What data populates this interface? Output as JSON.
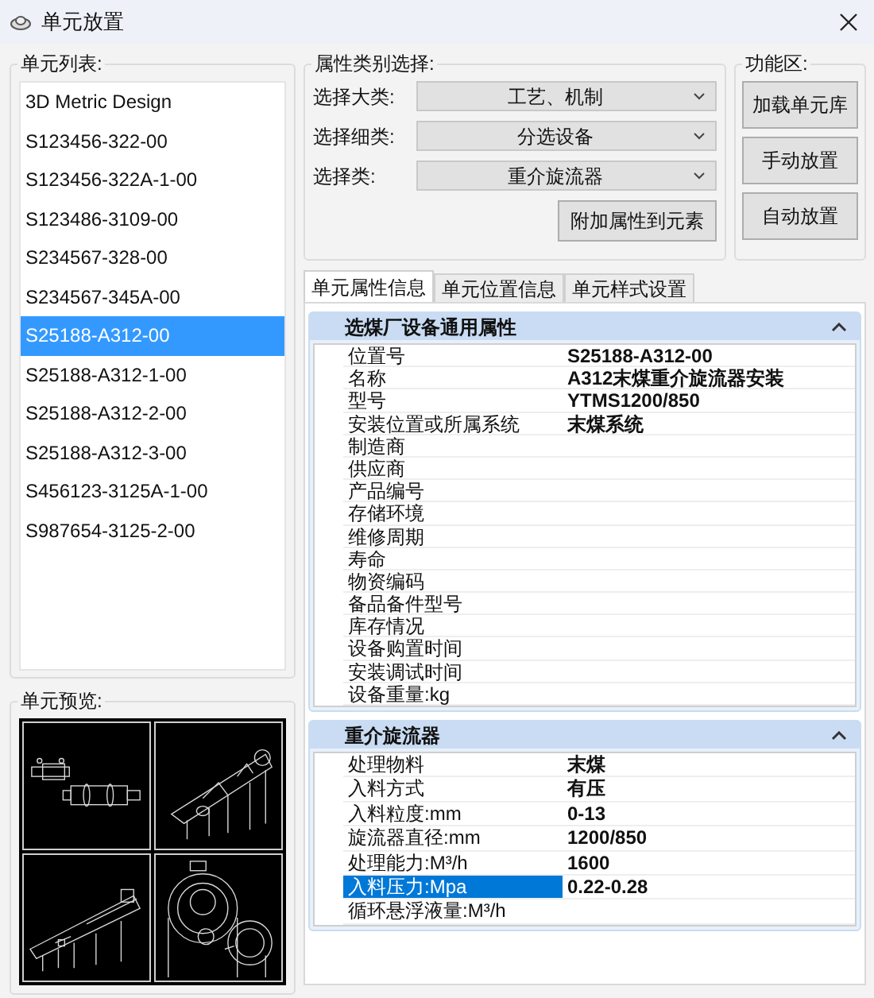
{
  "window": {
    "title": "单元放置"
  },
  "unit_list": {
    "label": "单元列表:",
    "items": [
      {
        "name": "3D Metric Design",
        "selected": false
      },
      {
        "name": "S123456-322-00",
        "selected": false
      },
      {
        "name": "S123456-322A-1-00",
        "selected": false
      },
      {
        "name": "S123486-3109-00",
        "selected": false
      },
      {
        "name": "S234567-328-00",
        "selected": false
      },
      {
        "name": "S234567-345A-00",
        "selected": false
      },
      {
        "name": "S25188-A312-00",
        "selected": true
      },
      {
        "name": "S25188-A312-1-00",
        "selected": false
      },
      {
        "name": "S25188-A312-2-00",
        "selected": false
      },
      {
        "name": "S25188-A312-3-00",
        "selected": false
      },
      {
        "name": "S456123-3125A-1-00",
        "selected": false
      },
      {
        "name": "S987654-3125-2-00",
        "selected": false
      }
    ]
  },
  "preview": {
    "label": "单元预览:"
  },
  "category": {
    "label": "属性类别选择:",
    "selects": [
      {
        "label": "选择大类:",
        "value": "工艺、机制"
      },
      {
        "label": "选择细类:",
        "value": "分选设备"
      },
      {
        "label": "选择类:",
        "value": "重介旋流器"
      }
    ],
    "button": "附加属性到元素"
  },
  "functions": {
    "label": "功能区:",
    "buttons": [
      "加载单元库",
      "手动放置",
      "自动放置"
    ]
  },
  "tabs": [
    {
      "label": "单元属性信息",
      "selected": true
    },
    {
      "label": "单元位置信息",
      "selected": false
    },
    {
      "label": "单元样式设置",
      "selected": false
    }
  ],
  "groups": [
    {
      "title": "选煤厂设备通用属性",
      "expanded": true,
      "rows": [
        {
          "name": "位置号",
          "value": "S25188-A312-00",
          "selected": false
        },
        {
          "name": "名称",
          "value": "A312末煤重介旋流器安装",
          "selected": false
        },
        {
          "name": "型号",
          "value": "YTMS1200/850",
          "selected": false
        },
        {
          "name": "安装位置或所属系统",
          "value": "末煤系统",
          "selected": false
        },
        {
          "name": "制造商",
          "selected": false
        },
        {
          "name": "供应商",
          "selected": false
        },
        {
          "name": "产品编号",
          "selected": false
        },
        {
          "name": "存储环境",
          "selected": false
        },
        {
          "name": "维修周期",
          "selected": false
        },
        {
          "name": "寿命",
          "selected": false
        },
        {
          "name": "物资编码",
          "selected": false
        },
        {
          "name": "备品备件型号",
          "selected": false
        },
        {
          "name": "库存情况",
          "selected": false
        },
        {
          "name": "设备购置时间",
          "selected": false
        },
        {
          "name": "安装调试时间",
          "selected": false
        },
        {
          "name": "设备重量:kg",
          "selected": false
        }
      ]
    },
    {
      "title": "重介旋流器",
      "expanded": true,
      "rows": [
        {
          "name": "处理物料",
          "value": "末煤",
          "selected": false
        },
        {
          "name": "入料方式",
          "value": "有压",
          "selected": false
        },
        {
          "name": "入料粒度:mm",
          "value": "0-13",
          "selected": false
        },
        {
          "name": "旋流器直径:mm",
          "value": "1200/850",
          "selected": false
        },
        {
          "name": "处理能力:M³/h",
          "value": "1600",
          "selected": false
        },
        {
          "name": "入料压力:Mpa",
          "value": "0.22-0.28",
          "selected": true
        },
        {
          "name": "循环悬浮液量:M³/h",
          "selected": false
        }
      ]
    }
  ]
}
